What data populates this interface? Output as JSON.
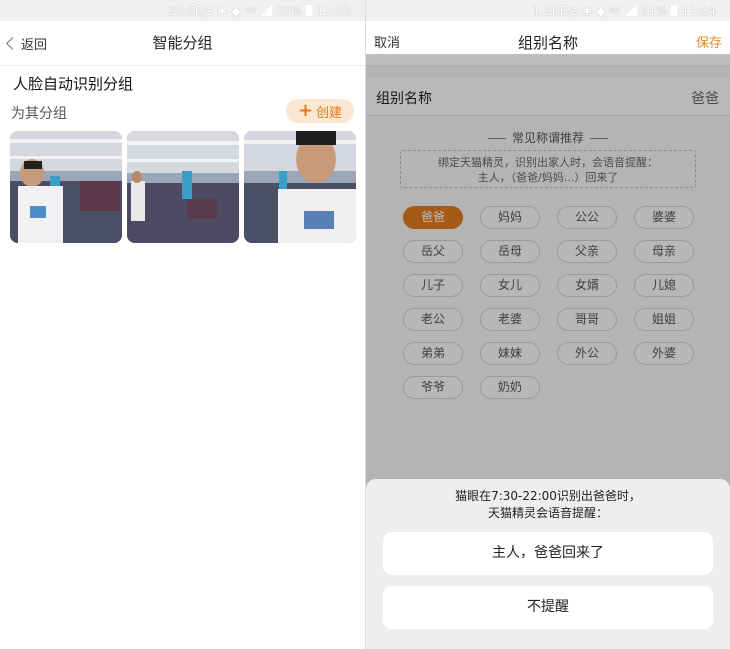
{
  "left": {
    "status": {
      "speed": "20.0B/s",
      "net": "4G",
      "battery": "30%",
      "time": "11:03"
    },
    "nav": {
      "back_label": "返回",
      "title": "智能分组"
    },
    "section_title": "人脸自动识别分组",
    "group_label": "为其分组",
    "create_label": "创建",
    "photos": [
      {
        "alt": "face-photo-1"
      },
      {
        "alt": "face-photo-2"
      },
      {
        "alt": "face-photo-3"
      }
    ]
  },
  "right": {
    "status": {
      "speed": "1.2KB/s",
      "net": "4G",
      "battery": "31%",
      "time": "11:04"
    },
    "nav": {
      "cancel_label": "取消",
      "title": "组别名称",
      "save_label": "保存"
    },
    "name_label": "组别名称",
    "name_value": "爸爸",
    "recommend_title": "常见称谓推荐",
    "hint_line1": "绑定天猫精灵，识别出家人时，会语音提醒：",
    "hint_line2": "主人，（爸爸/妈妈...）回来了",
    "chips": [
      "爸爸",
      "妈妈",
      "公公",
      "婆婆",
      "岳父",
      "岳母",
      "父亲",
      "母亲",
      "儿子",
      "女儿",
      "女婿",
      "儿媳",
      "老公",
      "老婆",
      "哥哥",
      "姐姐",
      "弟弟",
      "妹妹",
      "外公",
      "外婆",
      "爷爷",
      "奶奶"
    ],
    "selected_chip": "爸爸",
    "sheet": {
      "message_line1": "猫眼在7:30-22:00识别出爸爸时，",
      "message_line2": "天猫精灵会语音提醒：",
      "option1": "主人，爸爸回来了",
      "option2": "不提醒"
    }
  },
  "colors": {
    "accent": "#e07a1f",
    "accent_light": "#fbe8d3"
  }
}
